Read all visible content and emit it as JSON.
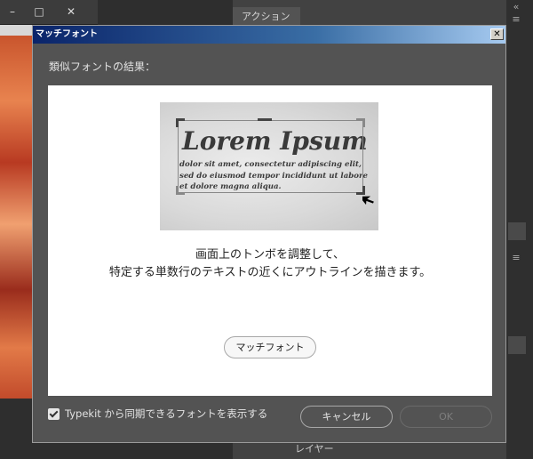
{
  "background": {
    "panel_tab": "アクション",
    "layer_label": "レイヤー",
    "window_buttons": [
      "–",
      "□",
      "✕"
    ]
  },
  "dialog": {
    "title": "マッチフォント",
    "close_label": "✕",
    "result_label": "類似フォントの結果：",
    "sample": {
      "title": "Lorem Ipsum",
      "body_lines": [
        "dolor sit amet, consectetur adipiscing elit,",
        "sed do eiusmod tempor incididunt ut labore",
        "et dolore magna aliqua."
      ]
    },
    "instruction_lines": [
      "画面上のトンボを調整して、",
      "特定する単数行のテキストの近くにアウトラインを描きます。"
    ],
    "match_button": "マッチフォント",
    "typekit_checkbox_label": "Typekit から同期できるフォントを表示する",
    "typekit_checked": true,
    "cancel_button": "キャンセル",
    "ok_button": "OK"
  },
  "colors": {
    "titlebar_start": "#0a246a",
    "titlebar_end": "#a6caf0",
    "dialog_bg": "#535353"
  }
}
